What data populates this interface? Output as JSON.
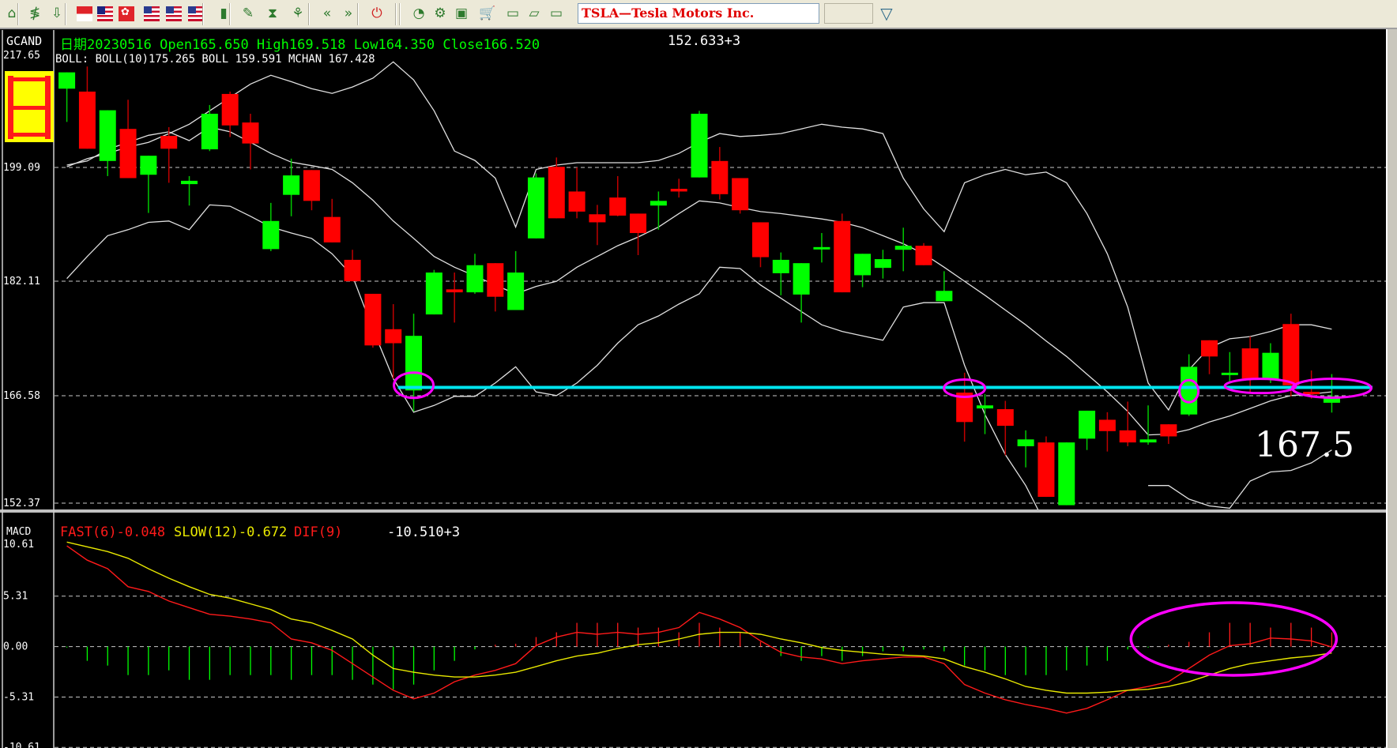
{
  "toolbar": {
    "icons": [
      "home-icon",
      "signal-icon",
      "download-icon",
      "singapore-flag-icon",
      "malaysia-flag-icon",
      "hongkong-flag-icon",
      "us-flag-icon",
      "us-flag-icon",
      "us-flag-icon",
      "bar-chart-icon",
      "edit-icon",
      "hourglass-icon",
      "network-icon",
      "rewind-icon",
      "fast-forward-icon",
      "power-icon",
      "rss-icon",
      "gear-icon",
      "window-icon",
      "cart-icon",
      "folder-icon",
      "open-folder-icon",
      "monitor-icon"
    ],
    "symbol_title": "TSLA—Tesla Motors Inc.",
    "dropdown_value": ""
  },
  "price_header": {
    "indicator": "GCAND",
    "ohlc": "日期20230516 Open165.650 High169.518 Low164.350 Close166.520",
    "right_value": "152.633+3",
    "boll_line": "BOLL: BOLL(10)175.265  BOLL 159.591  MCHAN 167.428"
  },
  "macd_header": {
    "name": "MACD",
    "fast": "FAST(6)-0.048",
    "slow": "SLOW(12)-0.672",
    "dif": "DIF(9)",
    "right_value": "-10.510+3"
  },
  "colors": {
    "up": "#00ff00",
    "down": "#ff0000",
    "band": "#e0e0e0",
    "fast": "#ff1a1a",
    "slow": "#e8e800",
    "annotation_line": "#00e5ee",
    "annotation_ellipse": "#ff00ff"
  },
  "chart_data": [
    {
      "type": "candlestick",
      "title": "",
      "price_axis": {
        "ticks": [
          217.65,
          199.09,
          182.11,
          166.58,
          152.37
        ],
        "tick_labels": [
          "217.65",
          "199.09",
          "182.11",
          "166.58",
          "152.37"
        ],
        "grid": "dashed"
      },
      "candles": [
        [
          212.6,
          215.4,
          206.9,
          215.4
        ],
        [
          212.1,
          216.4,
          202.3,
          202.3
        ],
        [
          200.2,
          208.9,
          197.8,
          208.9
        ],
        [
          205.7,
          210.7,
          197.5,
          197.5
        ],
        [
          198.0,
          201.1,
          192.3,
          201.1
        ],
        [
          204.5,
          206.0,
          196.8,
          202.3
        ],
        [
          196.6,
          197.8,
          193.4,
          197.1
        ],
        [
          202.2,
          209.8,
          201.9,
          208.3
        ],
        [
          211.7,
          212.1,
          204.3,
          206.3
        ],
        [
          206.8,
          208.3,
          198.8,
          203.2
        ],
        [
          186.9,
          193.8,
          186.6,
          191.1
        ],
        [
          195.0,
          200.6,
          191.8,
          197.9
        ],
        [
          198.7,
          198.7,
          192.7,
          194.1
        ],
        [
          191.7,
          194.4,
          187.9,
          187.9
        ],
        [
          185.3,
          186.8,
          182.1,
          182.1
        ],
        [
          180.4,
          180.4,
          173.1,
          173.4
        ],
        [
          175.6,
          179.0,
          168.9,
          173.7
        ],
        [
          167.3,
          177.7,
          164.5,
          174.7
        ],
        [
          177.6,
          183.8,
          177.6,
          183.4
        ],
        [
          181.0,
          183.4,
          176.5,
          180.6
        ],
        [
          180.6,
          186.2,
          180.4,
          184.5
        ],
        [
          184.8,
          184.8,
          178.0,
          180.0
        ],
        [
          178.2,
          186.6,
          178.2,
          183.4
        ],
        [
          188.5,
          198.2,
          188.5,
          197.6
        ],
        [
          199.2,
          200.8,
          191.5,
          191.5
        ],
        [
          195.5,
          199.1,
          191.5,
          192.5
        ],
        [
          192.1,
          193.5,
          187.5,
          190.9
        ],
        [
          194.6,
          197.8,
          191.8,
          191.9
        ],
        [
          192.2,
          192.2,
          186.0,
          189.3
        ],
        [
          193.4,
          195.5,
          189.8,
          194.1
        ],
        [
          195.9,
          197.4,
          194.6,
          195.5
        ],
        [
          197.6,
          208.8,
          197.6,
          208.3
        ],
        [
          200.2,
          202.6,
          194.3,
          195.1
        ],
        [
          197.5,
          197.5,
          192.2,
          192.7
        ],
        [
          190.9,
          190.9,
          184.2,
          185.7
        ],
        [
          183.3,
          186.4,
          180.2,
          185.3
        ],
        [
          180.3,
          184.8,
          176.5,
          184.8
        ],
        [
          186.9,
          189.3,
          184.9,
          187.2
        ],
        [
          191.1,
          192.2,
          180.6,
          180.6
        ],
        [
          183.0,
          186.2,
          181.3,
          186.2
        ],
        [
          184.1,
          186.8,
          182.5,
          185.4
        ],
        [
          186.8,
          190.1,
          183.6,
          187.4
        ],
        [
          187.4,
          187.8,
          184.5,
          184.5
        ],
        [
          179.4,
          183.6,
          179.4,
          180.8
        ],
        [
          167.0,
          169.7,
          160.5,
          163.1
        ],
        [
          164.9,
          166.8,
          161.5,
          165.3
        ],
        [
          164.8,
          165.9,
          158.7,
          162.6
        ],
        [
          159.9,
          162.0,
          157.1,
          160.8
        ],
        [
          160.4,
          161.2,
          153.2,
          153.2
        ],
        [
          152.1,
          160.4,
          152.1,
          160.4
        ],
        [
          160.9,
          164.6,
          159.4,
          164.6
        ],
        [
          163.4,
          164.4,
          159.2,
          161.9
        ],
        [
          162.0,
          165.8,
          159.9,
          160.4
        ],
        [
          160.4,
          165.3,
          160.1,
          160.8
        ],
        [
          162.8,
          162.8,
          160.2,
          161.2
        ],
        [
          164.1,
          172.2,
          163.9,
          170.5
        ],
        [
          174.1,
          174.1,
          169.5,
          171.9
        ],
        [
          169.4,
          172.5,
          168.5,
          169.7
        ],
        [
          173.0,
          174.6,
          167.1,
          168.9
        ],
        [
          168.8,
          173.7,
          168.3,
          172.4
        ],
        [
          176.3,
          177.7,
          166.5,
          168.0
        ],
        [
          167.1,
          170.0,
          166.2,
          166.8
        ],
        [
          165.65,
          169.518,
          164.35,
          166.52
        ]
      ],
      "candle_fields": [
        "open",
        "high",
        "low",
        "close"
      ],
      "boll_upper": [
        199.2,
        200.6,
        201.5,
        202.6,
        203.4,
        204.9,
        206.5,
        208.8,
        211.1,
        213.4,
        214.9,
        213.8,
        212.6,
        211.8,
        212.9,
        214.4,
        217.2,
        214.1,
        208.8,
        201.9,
        200.3,
        197.5,
        190.2,
        198.8,
        199.5,
        199.9,
        199.9,
        199.9,
        199.9,
        200.3,
        201.5,
        203.4,
        204.9,
        204.4,
        204.6,
        204.9,
        205.7,
        206.5,
        206.0,
        205.7,
        204.9,
        197.5,
        192.9,
        189.5,
        196.8,
        198.0,
        198.8,
        198.0,
        198.4,
        196.8,
        192.2,
        186.2,
        178.6,
        168.3,
        164.7,
        170.1,
        173.1,
        174.3,
        174.6,
        175.3,
        176.2,
        176.2,
        175.6
      ],
      "boll_middle": [
        199.5,
        200.2,
        202.2,
        203.4,
        204.6,
        205.2,
        203.7,
        206.0,
        205.2,
        203.4,
        201.5,
        200.0,
        199.4,
        198.8,
        196.8,
        194.2,
        191.1,
        188.5,
        185.8,
        184.2,
        182.9,
        181.6,
        180.4,
        181.4,
        182.1,
        184.2,
        185.8,
        187.4,
        188.7,
        190.2,
        192.2,
        194.1,
        193.8,
        193.1,
        192.5,
        192.2,
        191.8,
        191.4,
        190.9,
        190.1,
        188.9,
        187.7,
        186.2,
        184.2,
        182.1,
        180.2,
        178.2,
        176.2,
        174.0,
        171.9,
        169.5,
        167.1,
        164.5,
        161.4,
        161.5,
        162.1,
        163.1,
        163.9,
        164.9,
        165.9,
        166.6,
        166.8,
        167.1
      ],
      "boll_lower": [
        182.5,
        185.8,
        188.9,
        189.8,
        190.9,
        191.1,
        189.8,
        193.5,
        193.3,
        191.8,
        190.2,
        189.3,
        188.5,
        186.2,
        182.9,
        175.6,
        168.9,
        164.4,
        165.3,
        166.5,
        166.5,
        168.3,
        170.5,
        167.1,
        166.6,
        168.3,
        170.7,
        173.7,
        176.2,
        177.4,
        179.0,
        180.4,
        184.2,
        184.0,
        181.6,
        179.8,
        178.0,
        176.2,
        175.3,
        174.7,
        174.1,
        178.6,
        179.2,
        179.2,
        170.7,
        164.1,
        158.8,
        154.7,
        149.4,
        null,
        null,
        null,
        null,
        154.7,
        154.7,
        152.9,
        152.0,
        151.7,
        155.3,
        156.5,
        156.7,
        157.7,
        159.4
      ],
      "annotations": {
        "support_line": {
          "price": 167.7,
          "from_candle": 18
        },
        "ellipses": [
          {
            "candle": 18,
            "price": 168.0
          },
          {
            "candle": 45,
            "price": 167.6
          },
          {
            "candle": 56,
            "price": 167.2
          },
          {
            "candle": 59.5,
            "price": 167.9
          },
          {
            "candle": 63,
            "price": 167.6
          }
        ],
        "label": "167.5"
      }
    },
    {
      "type": "line",
      "title": "MACD",
      "y_axis": {
        "ticks": [
          10.61,
          5.31,
          0.0,
          -5.31,
          -10.61
        ],
        "tick_labels": [
          "10.61",
          "5.31",
          "0.00",
          "-5.31",
          "-10.61"
        ],
        "grid": "dashed"
      },
      "series": [
        {
          "name": "FAST(6)",
          "values": [
            10.6,
            9.1,
            8.2,
            6.3,
            5.8,
            4.8,
            4.1,
            3.4,
            3.2,
            2.9,
            2.5,
            0.8,
            0.4,
            -0.4,
            -1.8,
            -3.2,
            -4.6,
            -5.5,
            -4.9,
            -3.7,
            -3.0,
            -2.5,
            -1.8,
            0.1,
            1.0,
            1.5,
            1.3,
            1.5,
            1.3,
            1.5,
            2.0,
            3.6,
            2.9,
            2.0,
            0.6,
            -0.6,
            -1.1,
            -1.3,
            -1.8,
            -1.5,
            -1.3,
            -1.1,
            -1.1,
            -1.8,
            -4.0,
            -4.9,
            -5.6,
            -6.1,
            -6.5,
            -7.0,
            -6.5,
            -5.6,
            -4.6,
            -4.2,
            -3.7,
            -2.3,
            -0.9,
            0.1,
            0.3,
            0.9,
            0.8,
            0.6,
            -0.05
          ]
        },
        {
          "name": "SLOW(12)",
          "values": [
            11.0,
            10.5,
            10.0,
            9.3,
            8.2,
            7.2,
            6.3,
            5.5,
            5.1,
            4.5,
            3.9,
            2.9,
            2.5,
            1.7,
            0.8,
            -0.9,
            -2.3,
            -2.7,
            -3.0,
            -3.2,
            -3.2,
            -3.0,
            -2.7,
            -2.1,
            -1.5,
            -1.0,
            -0.7,
            -0.2,
            0.2,
            0.4,
            0.8,
            1.3,
            1.5,
            1.5,
            1.3,
            0.8,
            0.4,
            -0.1,
            -0.4,
            -0.6,
            -0.8,
            -0.9,
            -1.0,
            -1.3,
            -2.1,
            -2.7,
            -3.4,
            -4.2,
            -4.6,
            -4.9,
            -4.9,
            -4.8,
            -4.6,
            -4.5,
            -4.2,
            -3.7,
            -3.0,
            -2.3,
            -1.8,
            -1.5,
            -1.2,
            -1.0,
            -0.67
          ]
        },
        {
          "name": "DIF(9)",
          "type": "histogram",
          "values": [
            -0.1,
            -1.5,
            -2.0,
            -3.0,
            -3.0,
            -2.5,
            -3.5,
            -3.5,
            -3.0,
            -3.0,
            -3.0,
            -3.5,
            -3.0,
            -3.0,
            -3.5,
            -4.0,
            -4.5,
            -4.0,
            -2.5,
            -1.5,
            -0.3,
            0.2,
            0.3,
            1.0,
            1.5,
            2.5,
            2.5,
            2.5,
            2.0,
            2.0,
            1.5,
            2.5,
            2.0,
            1.5,
            0.5,
            -1.0,
            -1.5,
            -1.0,
            -1.5,
            -1.0,
            -0.5,
            -0.5,
            -0.3,
            -0.5,
            -2.0,
            -2.5,
            -3.0,
            -3.0,
            -3.0,
            -2.5,
            -2.0,
            -1.5,
            -0.3,
            -0.1,
            0.2,
            0.5,
            1.5,
            2.5,
            2.5,
            2.0,
            2.5,
            2.0,
            1.5
          ]
        }
      ],
      "annotations": {
        "ellipse": {
          "candle": 58,
          "value": 0.8
        }
      }
    }
  ]
}
